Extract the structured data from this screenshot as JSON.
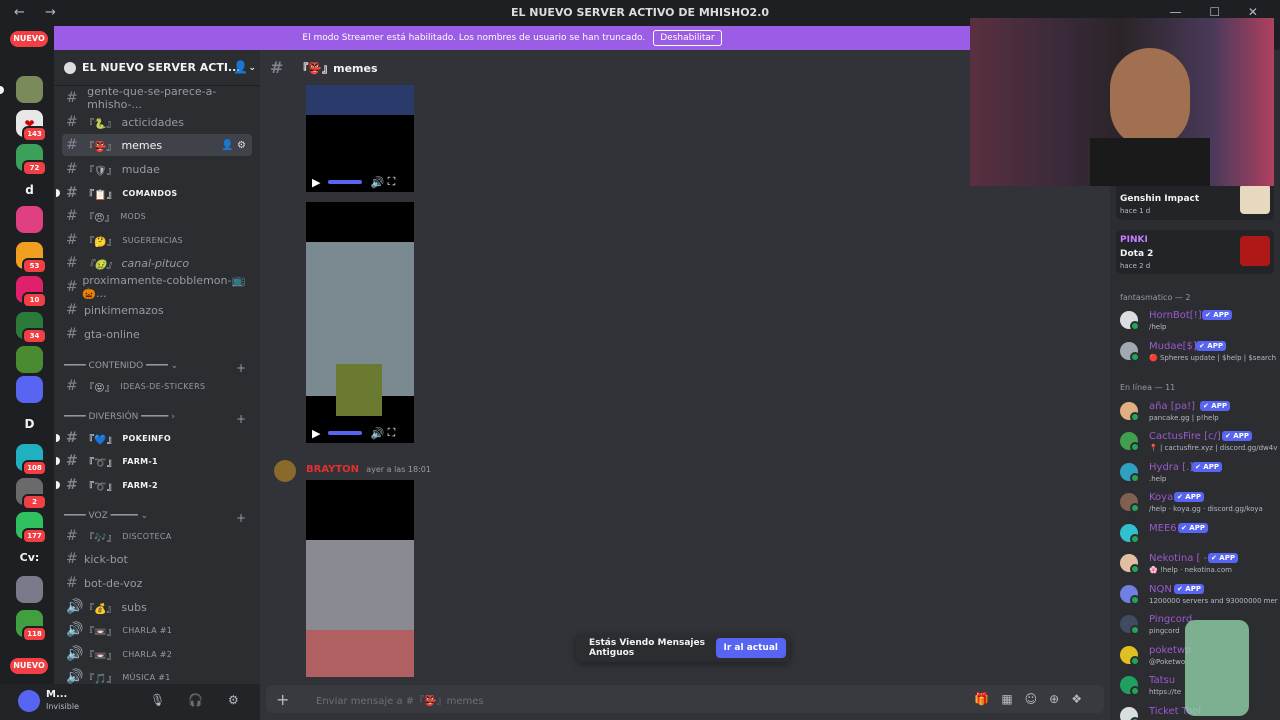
{
  "window": {
    "title": "EL NUEVO SERVER ACTIVO DE MHISHO2.0",
    "nav": "← →",
    "controls": "— ☐ ✕"
  },
  "banner": {
    "text": "El modo Streamer está habilitado. Los nombres de usuario se han truncado.",
    "button": "Deshabilitar"
  },
  "serverbar": {
    "new_label": "NUEVO",
    "badges": [
      "143",
      "72",
      "53",
      "10",
      "34",
      "108",
      "2",
      "177",
      "118"
    ],
    "letters": [
      "d",
      "D",
      "Cv:"
    ]
  },
  "guild": {
    "name": "EL NUEVO SERVER ACTI..."
  },
  "channels": [
    {
      "name": "gente-que-se-parece-a-mhisho-...",
      "emoji": ""
    },
    {
      "name": "acticidades",
      "emoji": "『🐍』"
    },
    {
      "name": "memes",
      "emoji": "『👺』"
    },
    {
      "name": "mudae",
      "emoji": "『🛡』"
    },
    {
      "name": "COMANDOS",
      "emoji": "『📋』"
    },
    {
      "name": "MODS",
      "emoji": "『😠』"
    },
    {
      "name": "SUGERENCIAS",
      "emoji": "『🤔』"
    },
    {
      "name": "canal-pituco",
      "emoji": "『🤢』"
    },
    {
      "name": "proximamente-cobblemon-📺🎃...",
      "emoji": ""
    },
    {
      "name": "pinkimemazos",
      "emoji": ""
    },
    {
      "name": "gta-online",
      "emoji": ""
    },
    {
      "name": "IDEAS-DE-STICKERS",
      "emoji": "『😝』"
    },
    {
      "name": "POKEINFO",
      "emoji": "『💙』"
    },
    {
      "name": "FARM-1",
      "emoji": "『➰』"
    },
    {
      "name": "FARM-2",
      "emoji": "『➰』"
    },
    {
      "name": "DISCOTECA",
      "emoji": "『🎶』"
    },
    {
      "name": "kick-bot",
      "emoji": ""
    },
    {
      "name": "bot-de-voz",
      "emoji": ""
    },
    {
      "name": "subs",
      "emoji": "『💰』"
    },
    {
      "name": "CHARLA #1",
      "emoji": "『📼』"
    },
    {
      "name": "CHARLA #2",
      "emoji": "『📼』"
    },
    {
      "name": "MÚSICA #1",
      "emoji": "『🎵』"
    }
  ],
  "categories": [
    "━━━━ CONTENIDO ━━━━",
    "━━━━ DIVERSIÓN ━━━━━",
    "━━━━ VOZ ━━━━━"
  ],
  "user": {
    "name": "M...",
    "status": "Invisible"
  },
  "chat": {
    "channel": "『👺』memes",
    "author": "BRAYTON",
    "timestamp": "ayer a las 18:01",
    "old_messages": "Estás Viendo Mensajes Antiguos",
    "jump_button": "Ir al actual",
    "placeholder": "Enviar mensaje a #『👺』memes"
  },
  "activities": [
    {
      "user": "",
      "game": "Genshin Impact",
      "time": "hace 1 d"
    },
    {
      "user": "PINKI",
      "game": "Dota 2",
      "time": "hace 2 d"
    }
  ],
  "member_groups": [
    "fantasmatico — 2",
    "En línea — 11"
  ],
  "app_label": "✔ APP",
  "members_bots": [
    {
      "name": "HornBot[!]",
      "status": "/help"
    },
    {
      "name": "Mudae[$]",
      "status": "🔴 Spheres update | $help | $search"
    }
  ],
  "members_online": [
    {
      "name": "aña [pa!]",
      "status": "pancake.gg | p!help"
    },
    {
      "name": "CactusFire [c/]",
      "status": "📍 | cactusfire.xyz | discord.gg/dw4v"
    },
    {
      "name": "Hydra [.]",
      "status": ".help"
    },
    {
      "name": "Koya",
      "status": "/help · koya.gg · discord.gg/koya"
    },
    {
      "name": "MEE6",
      "status": ""
    },
    {
      "name": "Nekotina [ - ]",
      "status": "🌸 !help · nekotina.com"
    },
    {
      "name": "NQN",
      "status": "1200000 servers and 93000000 mer"
    },
    {
      "name": "Pingcord",
      "status": "pingcord"
    },
    {
      "name": "poketwo",
      "status": "@Poketwo"
    },
    {
      "name": "Tatsu",
      "status": "https://te"
    },
    {
      "name": "Ticket Tool",
      "status": ""
    }
  ]
}
